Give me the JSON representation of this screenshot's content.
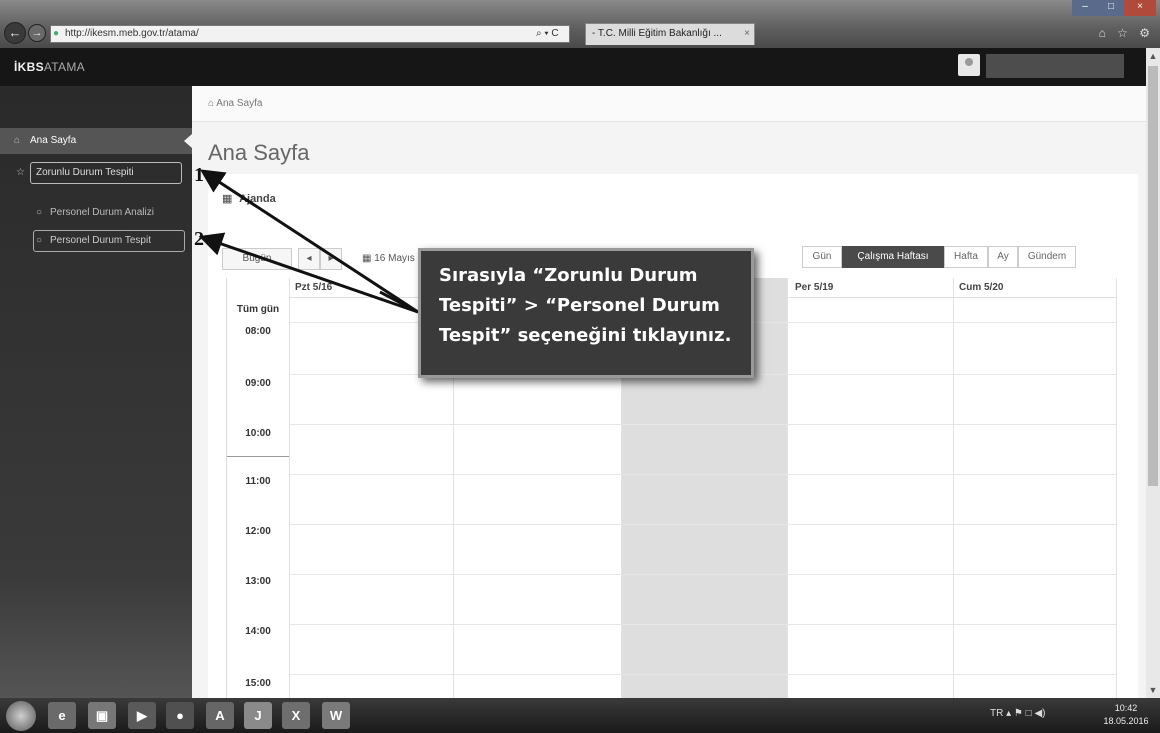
{
  "browser": {
    "url": "http://ikesm.meb.gov.tr/atama/",
    "address_tools": "⌕ ▾ C",
    "tab_title": "- T.C. Milli Eğitim Bakanlığı ...",
    "nav_back": "←",
    "nav_forward": "→",
    "icons": "⌂ ☆ ⚙"
  },
  "app": {
    "brand_bold": "İKBS",
    "brand_light": "ATAMA"
  },
  "sidebar": {
    "items": [
      {
        "label": "Ana Sayfa",
        "icon": "home-icon"
      },
      {
        "label": "Zorunlu Durum Tespiti",
        "icon": "star-icon"
      },
      {
        "label": "Personel Durum Analizi",
        "icon": "circle-icon"
      },
      {
        "label": "Personel Durum Tespit",
        "icon": "circle-icon"
      }
    ]
  },
  "main": {
    "breadcrumb": "Ana Sayfa",
    "page_title": "Ana Sayfa",
    "agenda_title": "Ajanda",
    "toolbar": {
      "today": "Bugün",
      "prev": "◂",
      "next": "▸",
      "date": "16 Mayıs"
    },
    "views": [
      "Gün",
      "Çalışma Haftası",
      "Hafta",
      "Ay",
      "Gündem"
    ],
    "active_view": "Çalışma Haftası",
    "days": {
      "monday": "Pzt 5/16",
      "thursday": "Per 5/19",
      "friday": "Cum 5/20"
    },
    "all_day": "Tüm gün",
    "times": [
      "08:00",
      "09:00",
      "10:00",
      "11:00",
      "12:00",
      "13:00",
      "14:00",
      "15:00"
    ]
  },
  "callout": {
    "line1": "Sırasıyla “Zorunlu Durum",
    "line2": "Tespiti” > “Personel Durum",
    "line3": "Tespit” seçeneğini tıklayınız.",
    "marker1": "1",
    "marker2": "2"
  },
  "tray": {
    "lang": "TR  ▴  ⚑  □  ◀)",
    "time": "10:42",
    "date": "18.05.2016"
  },
  "taskbar": {
    "word": "W",
    "excel": "X",
    "java": "J",
    "acrobat": "A",
    "media": "▶",
    "ie": "e",
    "chrome": "●"
  },
  "colors": {
    "active_view_bg": "#4a4a4a",
    "sidebar_bg": "#2a2a2a",
    "header_bg": "#161616",
    "callout_bg": "#3a3a3a"
  }
}
